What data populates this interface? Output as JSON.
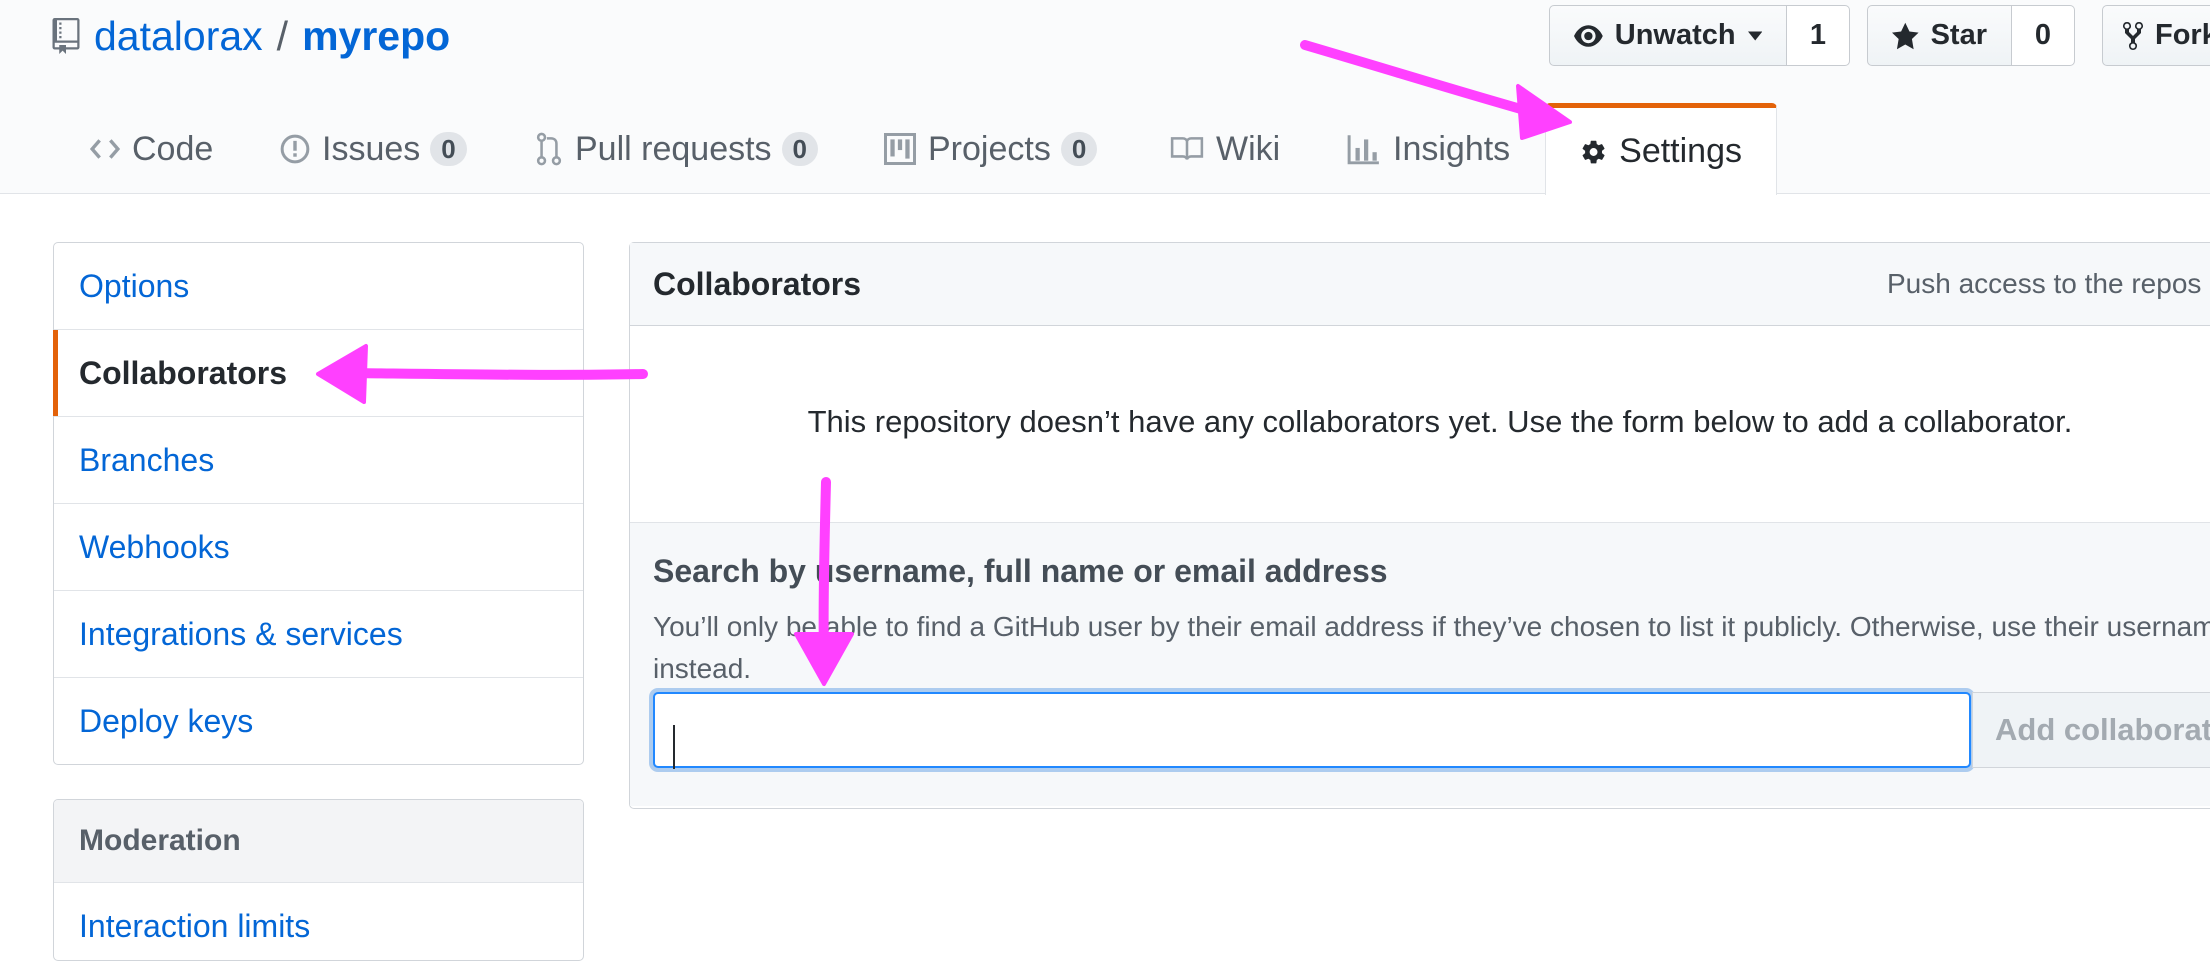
{
  "repo": {
    "owner": "datalorax",
    "separator": "/",
    "name": "myrepo"
  },
  "actions": {
    "watch": {
      "label": "Unwatch",
      "count": "1"
    },
    "star": {
      "label": "Star",
      "count": "0"
    },
    "fork": {
      "label": "Fork"
    }
  },
  "tabs": [
    {
      "label": "Code",
      "icon": "code-icon"
    },
    {
      "label": "Issues",
      "count": "0",
      "icon": "issue-opened-icon"
    },
    {
      "label": "Pull requests",
      "count": "0",
      "icon": "git-pull-request-icon"
    },
    {
      "label": "Projects",
      "count": "0",
      "icon": "project-icon"
    },
    {
      "label": "Wiki",
      "icon": "book-icon"
    },
    {
      "label": "Insights",
      "icon": "graph-icon"
    },
    {
      "label": "Settings",
      "icon": "gear-icon",
      "selected": true
    }
  ],
  "sidebar": {
    "items": [
      {
        "label": "Options"
      },
      {
        "label": "Collaborators",
        "selected": true
      },
      {
        "label": "Branches"
      },
      {
        "label": "Webhooks"
      },
      {
        "label": "Integrations & services"
      },
      {
        "label": "Deploy keys"
      }
    ],
    "moderation": {
      "heading": "Moderation",
      "items": [
        {
          "label": "Interaction limits"
        }
      ]
    }
  },
  "collaborators": {
    "title": "Collaborators",
    "description": "Push access to the repos",
    "empty_message": "This repository doesn’t have any collaborators yet. Use the form below to add a collaborator.",
    "search_title": "Search by username, full name or email address",
    "search_note": "You’ll only be able to find a GitHub user by their email address if they’ve chosen to list it publicly. Otherwise, use their username instead.",
    "input_value": "",
    "add_button": "Add collaborator"
  },
  "colors": {
    "link": "#0366d6",
    "accent_orange": "#e36209",
    "annotation_arrow": "#ff40ff",
    "focus_ring": "#2188ff"
  }
}
